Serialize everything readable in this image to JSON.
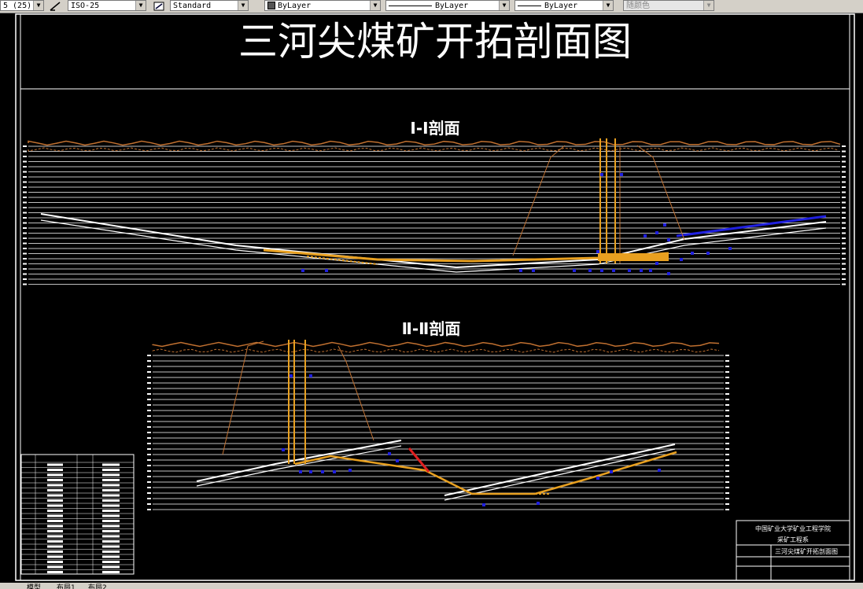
{
  "toolbar": {
    "scale_value": "5 (25)",
    "dimstyle": "ISO-25",
    "textstyle": "Standard",
    "color": "ByLayer",
    "linetype": "ByLayer",
    "lineweight": "ByLayer",
    "plotstyle": "随颜色"
  },
  "drawing": {
    "title": "三河尖煤矿开拓剖面图",
    "section1_title": "I-I剖面",
    "section2_title": "Ⅱ-Ⅱ剖面",
    "title_block": {
      "school": "中国矿业大学矿业工程学院",
      "dept": "采矿工程系",
      "name": "三河尖煤矿开拓剖面图"
    }
  },
  "tabs": {
    "model": "模型",
    "layout1": "布局1",
    "layout2": "布局2"
  },
  "colors": {
    "background": "#000000",
    "orange": "#e8a020",
    "blue": "#2020e0",
    "red": "#e02020",
    "surface": "#c07030"
  }
}
